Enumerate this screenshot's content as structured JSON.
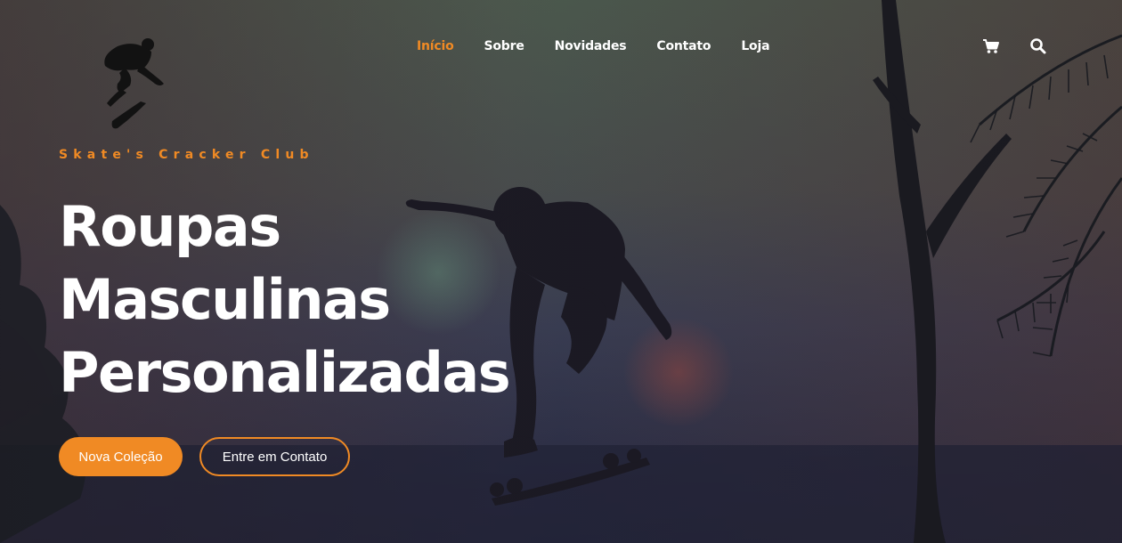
{
  "colors": {
    "accent": "#f08a24",
    "text": "#ffffff",
    "sky_top": "#4c5a52",
    "sky_bottom": "#2c2d45"
  },
  "header": {
    "logo_icon": "skater-logo-icon",
    "nav": [
      {
        "label": "Início",
        "active": true
      },
      {
        "label": "Sobre",
        "active": false
      },
      {
        "label": "Novidades",
        "active": false
      },
      {
        "label": "Contato",
        "active": false
      },
      {
        "label": "Loja",
        "active": false
      }
    ],
    "icons": [
      "shopping-cart-icon",
      "search-icon"
    ]
  },
  "hero": {
    "tagline": "Skate's Cracker Club",
    "headline": [
      "Roupas",
      "Masculinas",
      "Personalizadas"
    ],
    "primary_button": "Nova Coleção",
    "secondary_button": "Entre em Contato"
  }
}
